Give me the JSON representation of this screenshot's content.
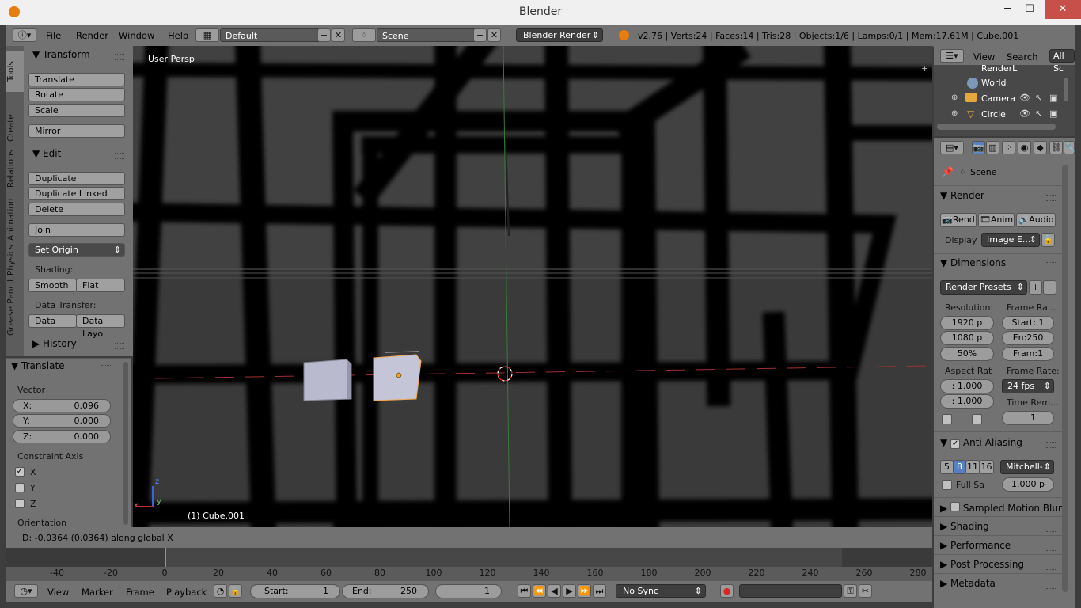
{
  "window": {
    "title": "Blender",
    "min": "─",
    "max": "☐",
    "close": "✕"
  },
  "header": {
    "menus": [
      "File",
      "Render",
      "Window",
      "Help"
    ],
    "layout": "Default",
    "scene": "Scene",
    "engine": "Blender Render",
    "stats": "v2.76 | Verts:24 | Faces:14 | Tris:28 | Objects:1/6 | Lamps:0/1 | Mem:17.61M | Cube.001"
  },
  "toolshelf": {
    "tabs": [
      "Tools",
      "Create",
      "Relations",
      "Animation",
      "Physics",
      "Grease Pencil"
    ],
    "transform": {
      "title": "Transform",
      "buttons": [
        "Translate",
        "Rotate",
        "Scale"
      ],
      "mirror": "Mirror"
    },
    "edit": {
      "title": "Edit",
      "buttons": [
        "Duplicate",
        "Duplicate Linked",
        "Delete"
      ],
      "join": "Join",
      "set_origin": "Set Origin"
    },
    "shading": {
      "label": "Shading:",
      "smooth": "Smooth",
      "flat": "Flat"
    },
    "data_transfer": {
      "label": "Data Transfer:",
      "data": "Data",
      "data_layout": "Data Layo"
    },
    "history": "History"
  },
  "operator": {
    "title": "Translate",
    "vector_label": "Vector",
    "x_label": "X:",
    "x": "0.096",
    "y_label": "Y:",
    "y": "0.000",
    "z_label": "Z:",
    "z": "0.000",
    "constraint_label": "Constraint Axis",
    "axes": [
      {
        "label": "X",
        "checked": true
      },
      {
        "label": "Y",
        "checked": false
      },
      {
        "label": "Z",
        "checked": false
      }
    ],
    "orientation_label": "Orientation"
  },
  "viewport": {
    "view_name": "User Persp",
    "object_label": "(1) Cube.001",
    "axis_z": "z",
    "axis_y": "y",
    "axis_x": "x"
  },
  "status": {
    "text": "D: -0.0364 (0.0364) along global X"
  },
  "timeline": {
    "ticks": [
      "-40",
      "-20",
      "0",
      "20",
      "40",
      "60",
      "80",
      "100",
      "120",
      "140",
      "160",
      "180",
      "200",
      "220",
      "240",
      "260",
      "280"
    ],
    "menus": [
      "View",
      "Marker",
      "Frame",
      "Playback"
    ],
    "start_label": "Start:",
    "start": "1",
    "end_label": "End:",
    "end": "250",
    "current": "1",
    "sync": "No Sync"
  },
  "outliner": {
    "menus": [
      "View",
      "Search"
    ],
    "all_scenes": "All Sc",
    "items": [
      "RenderL",
      "World",
      "Camera",
      "Circle"
    ]
  },
  "properties": {
    "scene": "Scene",
    "render": {
      "title": "Render",
      "rend": "Rend",
      "anim": "Anim",
      "audio": "Audio",
      "display_label": "Display",
      "display_value": "Image E..."
    },
    "dimensions": {
      "title": "Dimensions",
      "presets": "Render Presets",
      "resolution_label": "Resolution:",
      "res_x": "1920 p",
      "res_y": "1080 p",
      "res_pct": "50%",
      "frame_range_label": "Frame Ra...",
      "start": "Start: 1",
      "end": "En:250",
      "step": "Fram:1",
      "aspect_label": "Aspect Rat",
      "aspect_x": ": 1.000",
      "aspect_y": ": 1.000",
      "frame_rate_label": "Frame Rate:",
      "fps": "24 fps",
      "time_remap_label": "Time Rem...",
      "time_remap": "1"
    },
    "antialiasing": {
      "title": "Anti-Aliasing",
      "samples": [
        "5",
        "8",
        "11",
        "16"
      ],
      "filter": "Mitchell-",
      "full_sample": "Full Sa",
      "size": "1.000 p"
    },
    "collapsed": [
      "Sampled Motion Blur",
      "Shading",
      "Performance",
      "Post Processing",
      "Metadata"
    ]
  }
}
